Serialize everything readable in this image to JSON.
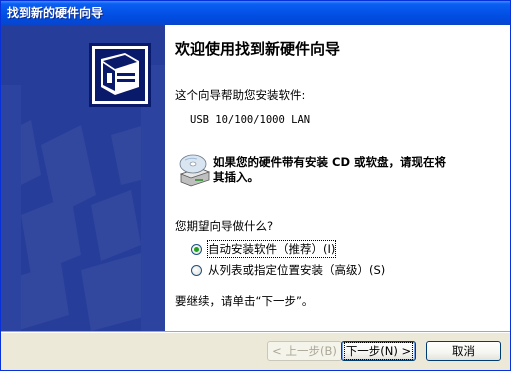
{
  "window": {
    "title": "找到新的硬件向导"
  },
  "content": {
    "heading": "欢迎使用找到新硬件向导",
    "intro": "这个向导帮助您安装软件:",
    "device_name": "USB 10/100/1000 LAN",
    "cd_hint_line1": "如果您的硬件带有安装 CD 或软盘，请现在将",
    "cd_hint_line2": "其插入。",
    "question": "您期望向导做什么?",
    "options": [
      {
        "label": "自动安装软件（推荐）(I)",
        "selected": true
      },
      {
        "label": "从列表或指定位置安装（高级）(S)",
        "selected": false
      }
    ],
    "continue_hint": "要继续，请单击“下一步”。"
  },
  "buttons": {
    "back": "< 上一步(B)",
    "next": "下一步(N) >",
    "cancel": "取消"
  },
  "colors": {
    "titlebar": "#0553e8",
    "banner": "#273d9a",
    "dialog_bg": "#ece9d8"
  },
  "icons": [
    "hardware-wizard-icon",
    "cd-drive-icon"
  ]
}
